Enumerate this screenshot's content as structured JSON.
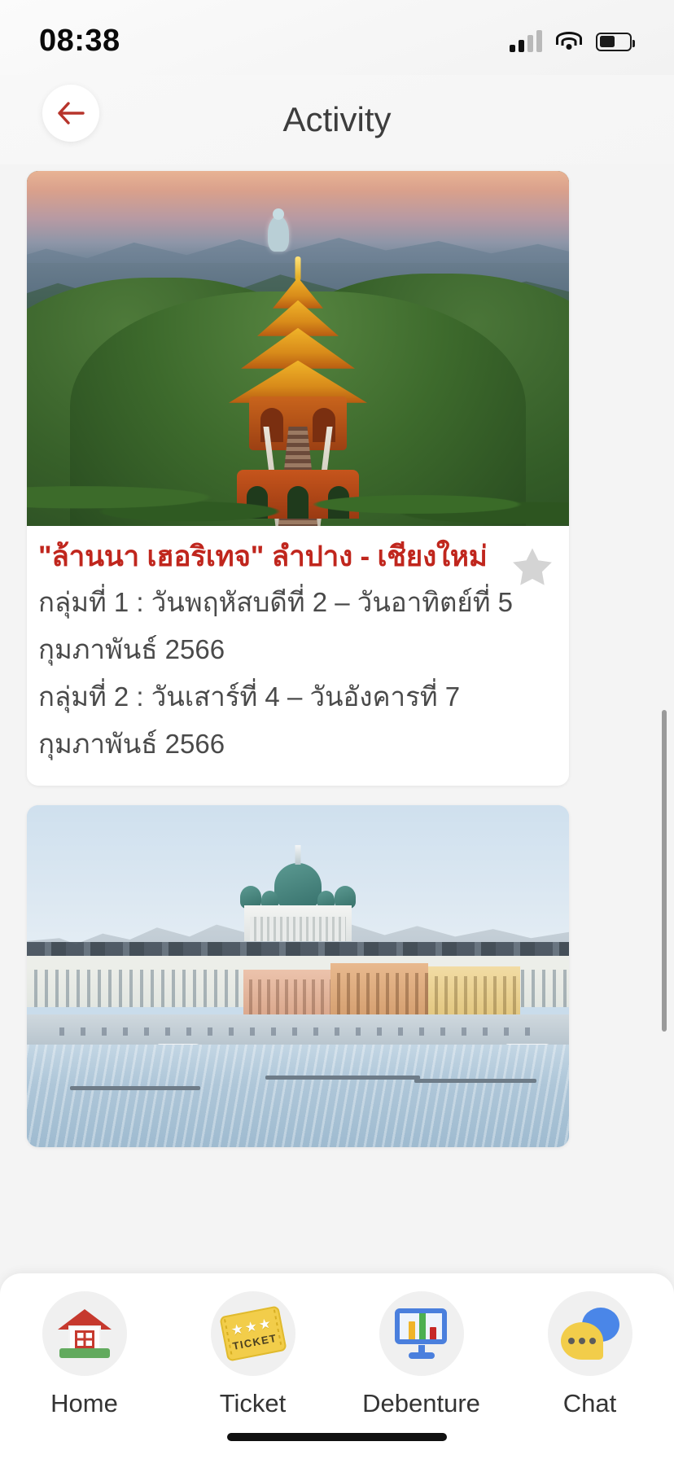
{
  "status_bar": {
    "time": "08:38",
    "signal_icon": "cellular-signal-icon",
    "wifi_icon": "wifi-icon",
    "battery_icon": "battery-icon"
  },
  "header": {
    "title": "Activity",
    "back_icon": "back-arrow-icon"
  },
  "cards": [
    {
      "image_name": "lanna-heritage-temple-photo",
      "title": "\"ล้านนา เฮอริเทจ\" ลำปาง - เชียงใหม่",
      "lines": [
        "กลุ่มที่ 1 : วันพฤหัสบดีที่ 2 – วันอาทิตย์ที่ 5",
        "กุมภาพันธ์ 2566",
        "กลุ่มที่ 2 : วันเสาร์ที่ 4 – วันอังคารที่ 7",
        "กุมภาพันธ์ 2566"
      ],
      "favorite_icon": "star-icon",
      "favorite_active": false,
      "favorite_color": "#d4d4d4"
    },
    {
      "image_name": "helsinki-winter-waterfront-photo",
      "title": "",
      "lines": [],
      "favorite_icon": "star-icon",
      "favorite_active": false,
      "favorite_color": "#d4d4d4"
    }
  ],
  "bottom_nav": {
    "items": [
      {
        "label": "Home",
        "icon": "home-icon"
      },
      {
        "label": "Ticket",
        "icon": "ticket-icon",
        "ticket_word": "TICKET",
        "ticket_stars": "★★★"
      },
      {
        "label": "Debenture",
        "icon": "monitor-chart-icon"
      },
      {
        "label": "Chat",
        "icon": "chat-bubbles-icon"
      }
    ]
  },
  "colors": {
    "accent_red": "#c0261d",
    "page_background": "#f4f4f4",
    "card_background": "#ffffff",
    "body_text": "#4a4a4a",
    "title_text": "#3d3d3d",
    "scrollbar": "#9a9a9a"
  }
}
